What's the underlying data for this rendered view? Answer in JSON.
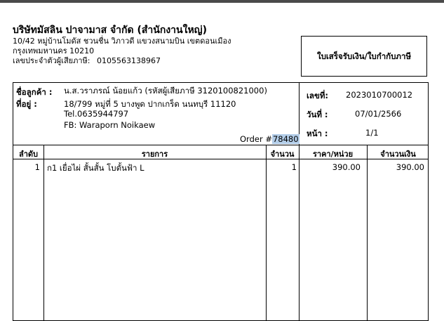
{
  "company": {
    "name": "บริษัทมัสลิน ปาจามาส จำกัด (สำนักงานใหญ่)",
    "address_line1": "10/42 หมู่บ้านโมดัส ชวนชื่น วิภาวดี แขวงสนามบิน เขตดอนเมือง",
    "address_line2": "กรุงเทพมหานคร 10210",
    "tax_label": "เลขประจำตัวผู้เสียภาษี:",
    "tax_id": "0105563138967"
  },
  "document": {
    "title": "ใบเสร็จรับเงิน/ใบกำกับภาษี"
  },
  "customer": {
    "name_label": "ชื่อลูกค้า :",
    "name": "น.ส.วราภรณ์ น้อยแก้ว (รหัสผู้เสียภาษี 3120100821000)",
    "address_label": "ที่อยู่ :",
    "address": "18/799 หมู่ที่ 5 บางพูด ปากเกร็ด นนทบุรี 11120",
    "tel": "Tel.0635944797",
    "fb": "FB: Waraporn Noikaew",
    "order_label": "Order #",
    "order_number": "78480"
  },
  "meta": {
    "number_label": "เลขที่:",
    "number": "2023010700012",
    "date_label": "วันที่ :",
    "date": "07/01/2566",
    "page_label": "หน้า :",
    "page": "1/1"
  },
  "table": {
    "headers": {
      "seq": "ลำดับ",
      "item": "รายการ",
      "qty": "จำนวน",
      "price": "ราคา/หน่วย",
      "amount": "จำนวนเงิน"
    },
    "rows": [
      {
        "seq": "1",
        "item": "ก1 เยื่อไผ่ สั้นสั้น โบตั้นฟ้า L",
        "qty": "1",
        "price": "390.00",
        "amount": "390.00"
      }
    ]
  }
}
